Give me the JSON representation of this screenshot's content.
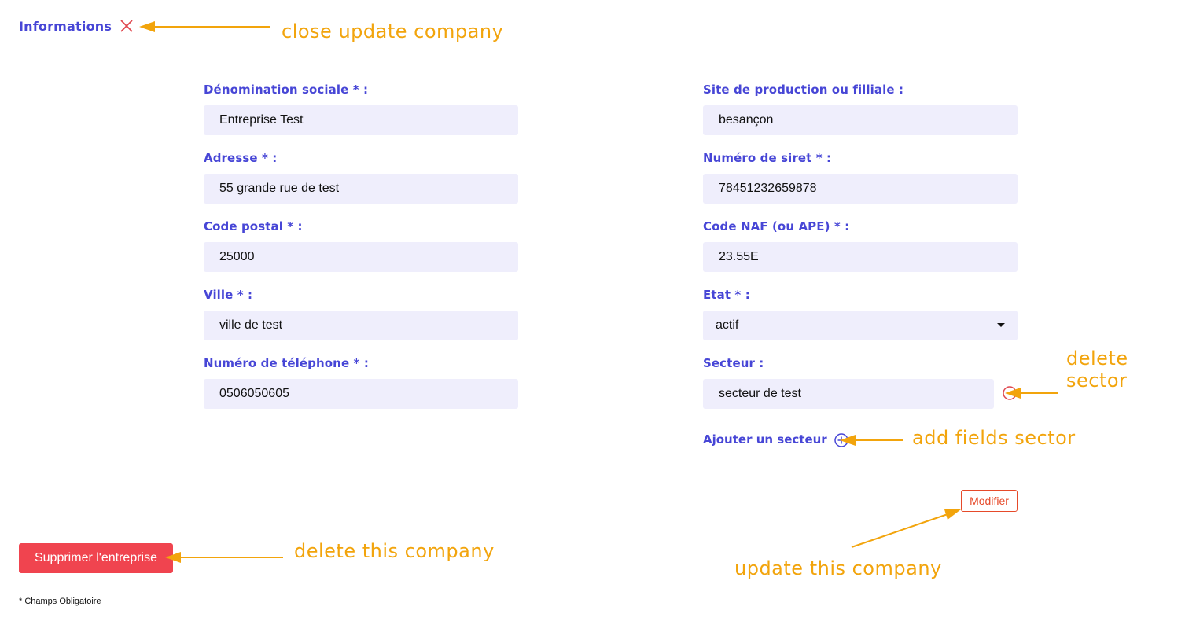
{
  "header": {
    "title": "Informations",
    "close_icon": "close-icon"
  },
  "left_fields": [
    {
      "label": "Dénomination sociale * :",
      "value": "Entreprise Test"
    },
    {
      "label": "Adresse * :",
      "value": "55 grande rue de test"
    },
    {
      "label": "Code postal * :",
      "value": "25000"
    },
    {
      "label": "Ville * :",
      "value": "ville de test"
    },
    {
      "label": "Numéro de téléphone * :",
      "value": "0506050605"
    }
  ],
  "right_fields": [
    {
      "label": "Site de production ou filliale :",
      "value": "besançon"
    },
    {
      "label": "Numéro de siret * :",
      "value": "78451232659878"
    },
    {
      "label": "Code NAF (ou APE) * :",
      "value": "23.55E"
    },
    {
      "label": "Etat * :",
      "value": "actif"
    },
    {
      "label": "Secteur :",
      "value": "secteur de test"
    }
  ],
  "add_sector_label": "Ajouter un secteur",
  "buttons": {
    "modifier": "Modifier",
    "delete_company": "Supprimer l'entreprise"
  },
  "footnote": "* Champs Obligatoire",
  "annotations": {
    "close": "close update company",
    "delete_sector_line1": "delete",
    "delete_sector_line2": "sector",
    "add_sector": "add fields sector",
    "delete_company": "delete this company",
    "update_company": "update this company"
  },
  "colors": {
    "accent": "#4746d6",
    "field_bg": "#efeefc",
    "danger": "#f0444f",
    "annotation": "#f2a40c"
  }
}
